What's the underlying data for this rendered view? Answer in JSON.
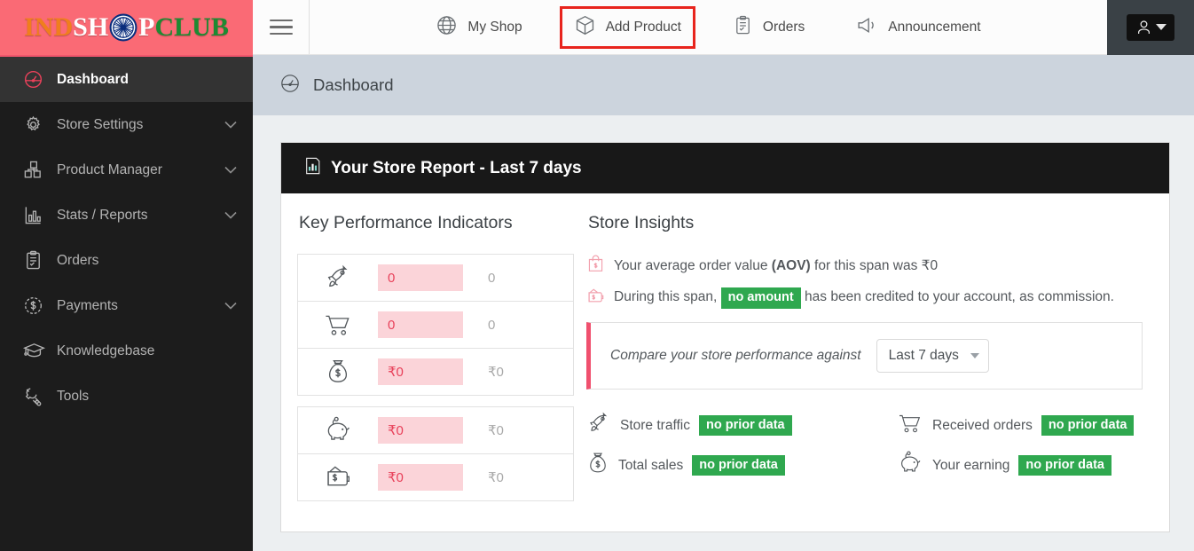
{
  "brand": {
    "logo_segments": [
      "IND",
      "SH",
      "P",
      "CLUB"
    ],
    "logo_full": "INDSHOPCLUB",
    "header_bg": "#fa6a75"
  },
  "topbar": {
    "menu_icon": "hamburger-icon",
    "items": [
      {
        "label": "My Shop",
        "icon": "globe-icon",
        "highlighted": false
      },
      {
        "label": "Add Product",
        "icon": "box-icon",
        "highlighted": true
      },
      {
        "label": "Orders",
        "icon": "clipboard-icon",
        "highlighted": false
      },
      {
        "label": "Announcement",
        "icon": "megaphone-icon",
        "highlighted": false
      }
    ],
    "highlight_color": "#e8241d",
    "avatar_icon": "user-icon"
  },
  "sidebar": {
    "items": [
      {
        "label": "Dashboard",
        "icon": "speedometer-icon",
        "active": true,
        "expandable": false
      },
      {
        "label": "Store Settings",
        "icon": "gear-icon",
        "active": false,
        "expandable": true
      },
      {
        "label": "Product Manager",
        "icon": "blocks-icon",
        "active": false,
        "expandable": true
      },
      {
        "label": "Stats / Reports",
        "icon": "bar-chart-icon",
        "active": false,
        "expandable": true
      },
      {
        "label": "Orders",
        "icon": "clipboard-icon",
        "active": false,
        "expandable": false
      },
      {
        "label": "Payments",
        "icon": "dollar-circle-icon",
        "active": false,
        "expandable": true
      },
      {
        "label": "Knowledgebase",
        "icon": "graduation-cap-icon",
        "active": false,
        "expandable": false
      },
      {
        "label": "Tools",
        "icon": "wrench-icon",
        "active": false,
        "expandable": false
      }
    ]
  },
  "breadcrumb": {
    "label": "Dashboard",
    "icon": "speedometer-icon"
  },
  "report": {
    "title": "Your Store Report - Last 7 days",
    "title_icon": "chart-report-icon",
    "kpi": {
      "heading": "Key Performance Indicators",
      "group_one": [
        {
          "icon": "rocket-icon",
          "value": "0",
          "previous": "0"
        },
        {
          "icon": "cart-icon",
          "value": "0",
          "previous": "0"
        },
        {
          "icon": "money-bag-icon",
          "value": "₹0",
          "previous": "₹0"
        }
      ],
      "group_two": [
        {
          "icon": "piggy-bank-icon",
          "value": "₹0",
          "previous": "₹0"
        },
        {
          "icon": "wallet-icon",
          "value": "₹0",
          "previous": "₹0"
        }
      ],
      "value_bg": "#fbd4d9",
      "value_color": "#e8415a"
    },
    "insights": {
      "heading": "Store Insights",
      "aov_line_pre": "Your average order value ",
      "aov_bold": "(AOV)",
      "aov_line_post": " for this span was ₹0",
      "aov_icon": "shopping-bag-icon",
      "commission_pre": "During this span, ",
      "commission_badge": "no amount",
      "commission_post": " has been credited to your account, as commission.",
      "commission_icon": "wallet-outline-icon",
      "badge_color": "#2fa84f"
    },
    "compare": {
      "label": "Compare your store performance against",
      "selected_option": "Last 7 days",
      "accent_color": "#f0506e",
      "metrics": [
        {
          "icon": "rocket-icon",
          "label": "Store traffic",
          "badge": "no prior data"
        },
        {
          "icon": "cart-icon",
          "label": "Received orders",
          "badge": "no prior data"
        },
        {
          "icon": "money-bag-icon",
          "label": "Total sales",
          "badge": "no prior data"
        },
        {
          "icon": "piggy-bank-icon",
          "label": "Your earning",
          "badge": "no prior data"
        }
      ]
    }
  }
}
